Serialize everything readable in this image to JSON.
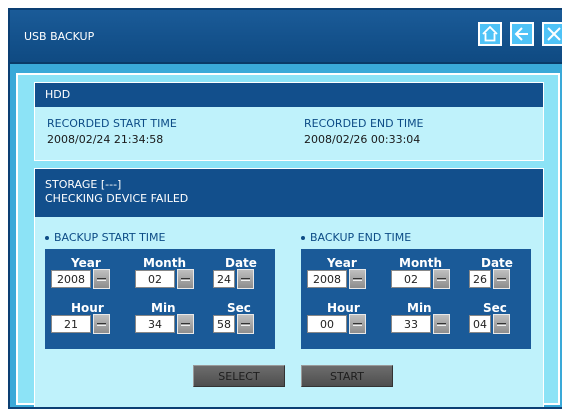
{
  "window": {
    "title": "USB BACKUP"
  },
  "titlebar_buttons": [
    {
      "icon": "home-icon"
    },
    {
      "icon": "back-arrow-icon"
    },
    {
      "icon": "close-icon"
    }
  ],
  "hdd": {
    "heading": "HDD",
    "start_label": "RECORDED START TIME",
    "start_value": "2008/02/24 21:34:58",
    "end_label": "RECORDED END TIME",
    "end_value": "2008/02/26 00:33:04"
  },
  "storage": {
    "line1": "STORAGE [---]",
    "line2": "CHECKING DEVICE FAILED"
  },
  "backup_start": {
    "title": "BACKUP START TIME",
    "year_label": "Year",
    "year": "2008",
    "month_label": "Month",
    "month": "02",
    "date_label": "Date",
    "date": "24",
    "hour_label": "Hour",
    "hour": "21",
    "min_label": "Min",
    "min": "34",
    "sec_label": "Sec",
    "sec": "58"
  },
  "backup_end": {
    "title": "BACKUP END TIME",
    "year_label": "Year",
    "year": "2008",
    "month_label": "Month",
    "month": "02",
    "date_label": "Date",
    "date": "26",
    "hour_label": "Hour",
    "hour": "00",
    "min_label": "Min",
    "min": "33",
    "sec_label": "Sec",
    "sec": "04"
  },
  "buttons": {
    "select": "SELECT",
    "start": "START"
  }
}
